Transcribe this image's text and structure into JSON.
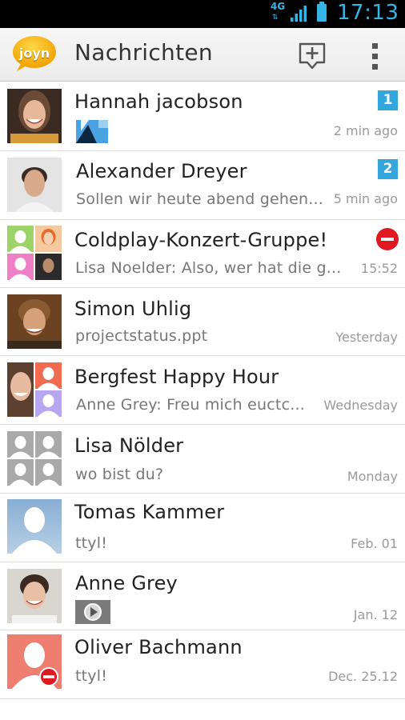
{
  "status_bar": {
    "network": "4G",
    "time": "17:13",
    "accent_color": "#33b5e5"
  },
  "header": {
    "logo_text": "joyn",
    "title": "Nachrichten",
    "compose_icon": "compose-message-icon",
    "overflow_icon": "overflow-menu-icon"
  },
  "colors": {
    "badge": "#33a7dd",
    "blocked": "#e01820"
  },
  "conversations": [
    {
      "name": "Hannah jacobson",
      "snippet": "",
      "attachment": "image-thumbnail",
      "time": "2 min ago",
      "unread": "1"
    },
    {
      "name": "Alexander Dreyer",
      "snippet": "Sollen wir heute abend gehen...",
      "time": "5 min ago",
      "unread": "2"
    },
    {
      "name": "Coldplay-Konzert-Gruppe!",
      "snippet": "Lisa Noelder: Also, wer hat die g...",
      "time": "15:52",
      "status_icon": "blocked-icon"
    },
    {
      "name": "Simon Uhlig",
      "snippet": "projectstatus.ppt",
      "time": "Yesterday"
    },
    {
      "name": "Bergfest Happy Hour",
      "snippet": "Anne Grey: Freu mich euctc...",
      "time": "Wednesday"
    },
    {
      "name": "Lisa Nölder",
      "snippet": "wo bist du?",
      "time": "Monday"
    },
    {
      "name": "Tomas Kammer",
      "snippet": "ttyl!",
      "time": "Feb. 01"
    },
    {
      "name": "Anne Grey",
      "snippet": "",
      "attachment": "video-thumbnail",
      "time": "Jan. 12"
    },
    {
      "name": "Oliver Bachmann",
      "snippet": "ttyl!",
      "time": "Dec. 25.12",
      "status_icon": "blocked-icon"
    }
  ]
}
